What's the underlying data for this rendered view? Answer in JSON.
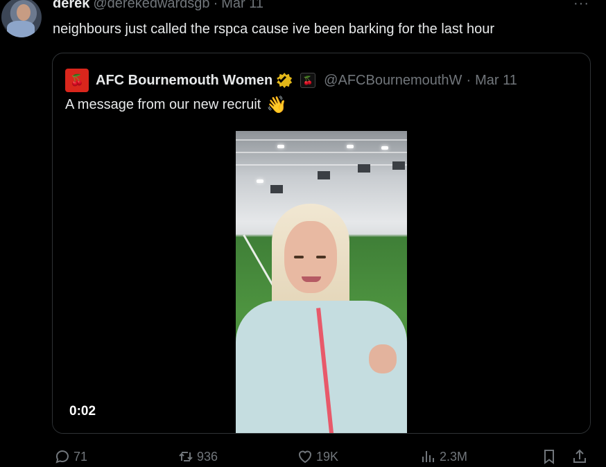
{
  "tweet": {
    "author_name": "derek",
    "handle": "@derekedwardsgb",
    "separator": "·",
    "date": "Mar 11",
    "more_label": "···",
    "text": "neighbours just called the rspca cause ive been barking for the last hour"
  },
  "quote": {
    "logo_text": "🍒",
    "author_name": "AFC Bournemouth Women",
    "verified_icon": "gold-verified-badge-icon",
    "affiliate_icon": "afc-bournemouth-affiliate-icon",
    "handle": "@AFCBournemouthW",
    "separator": "·",
    "date": "Mar 11",
    "text": "A message from our new recruit",
    "emoji": "👋",
    "video_time": "0:02"
  },
  "actions": {
    "replies": "71",
    "reposts": "936",
    "likes": "19K",
    "views": "2.3M"
  },
  "colors": {
    "background": "#000000",
    "text": "#e7e9ea",
    "muted": "#71767b",
    "border": "#2f3336",
    "verified_gold": "#e2b719",
    "club_red": "#d9261c"
  }
}
